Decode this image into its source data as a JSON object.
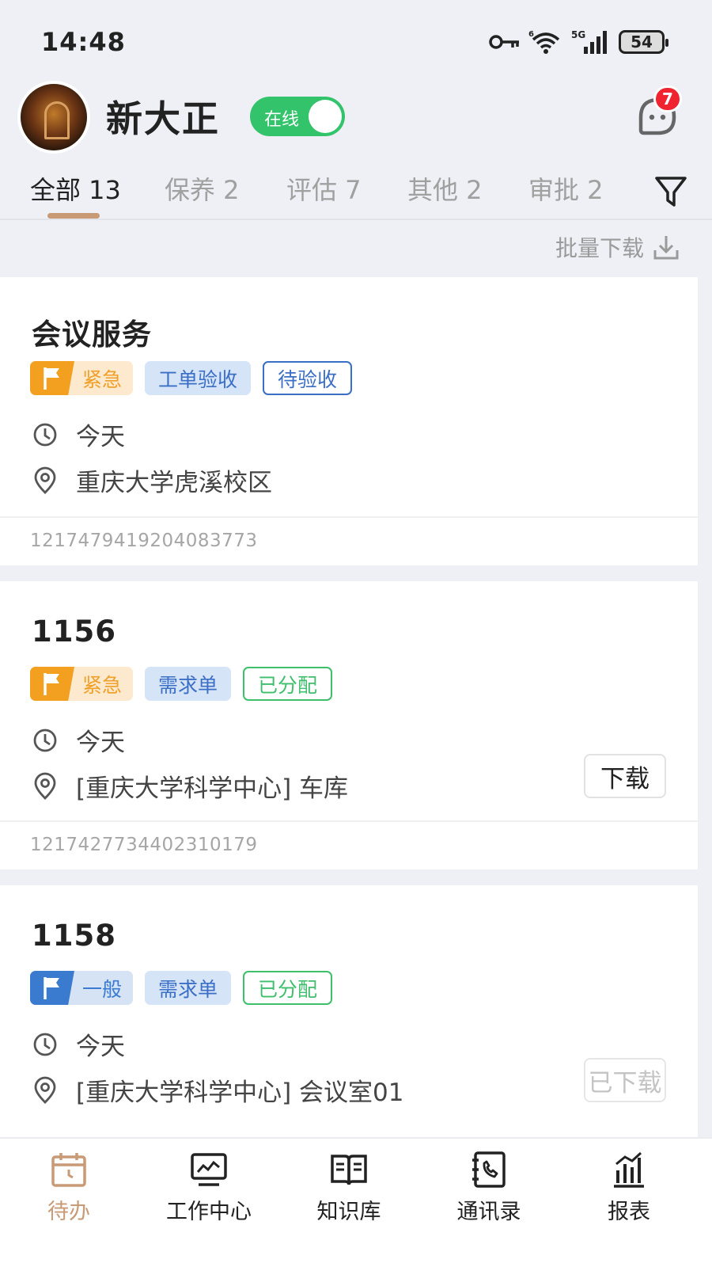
{
  "status_bar": {
    "time": "14:48",
    "signal_label": "5G",
    "signal_label_2": "6",
    "battery": "54"
  },
  "header": {
    "user_name": "新大正",
    "online_label": "在线",
    "message_badge": "7"
  },
  "tabs": [
    {
      "label": "全部 13",
      "active": true
    },
    {
      "label": "保养 2",
      "active": false
    },
    {
      "label": "评估 7",
      "active": false
    },
    {
      "label": "其他 2",
      "active": false
    },
    {
      "label": "审批 2",
      "active": false
    }
  ],
  "toolbar": {
    "batch_download_label": "批量下载"
  },
  "cards": [
    {
      "title": "会议服务",
      "priority": "紧急",
      "type": "工单验收",
      "status": "待验收",
      "time": "今天",
      "location": "重庆大学虎溪校区",
      "id": "1217479419204083773",
      "action": ""
    },
    {
      "title": "1156",
      "priority": "紧急",
      "type": "需求单",
      "status": "已分配",
      "time": "今天",
      "location": "[重庆大学科学中心] 车库",
      "id": "1217427734402310179",
      "action": "下载"
    },
    {
      "title": "1158",
      "priority": "一般",
      "type": "需求单",
      "status": "已分配",
      "time": "今天",
      "location": "[重庆大学科学中心] 会议室01",
      "action": "已下载"
    }
  ],
  "bottom_nav": [
    {
      "label": "待办",
      "icon": "calendar-icon",
      "active": true
    },
    {
      "label": "工作中心",
      "icon": "monitor-icon",
      "active": false
    },
    {
      "label": "知识库",
      "icon": "book-icon",
      "active": false
    },
    {
      "label": "通讯录",
      "icon": "phone-book-icon",
      "active": false
    },
    {
      "label": "报表",
      "icon": "bar-chart-icon",
      "active": false
    }
  ],
  "colors": {
    "accent": "#c99a76",
    "online_green": "#33c36b",
    "urgent_orange": "#f3a021",
    "normal_blue": "#3a7bd0",
    "badge_red": "#f0242f"
  }
}
